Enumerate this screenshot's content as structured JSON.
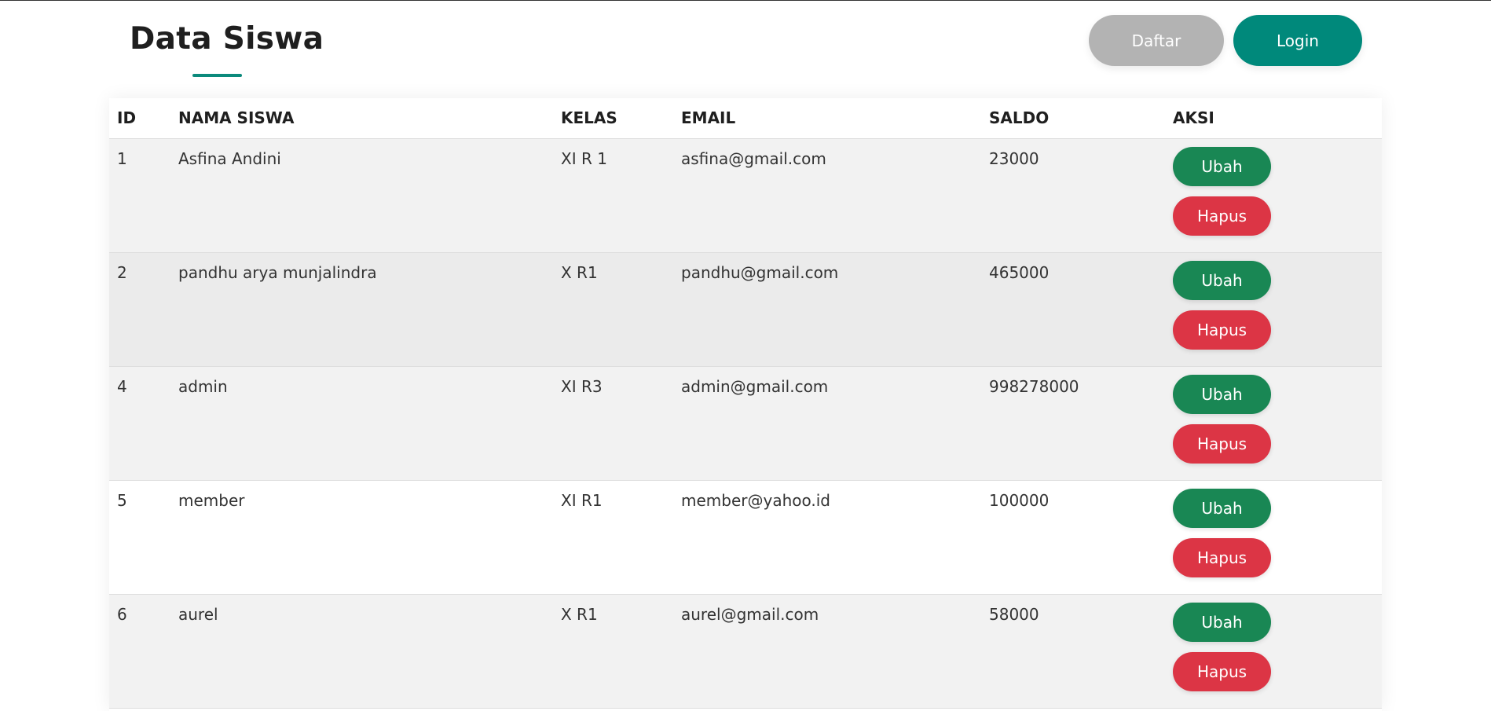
{
  "header": {
    "title": "Data Siswa",
    "daftar_label": "Daftar",
    "login_label": "Login"
  },
  "table": {
    "columns": {
      "id": "ID",
      "nama": "NAMA SISWA",
      "kelas": "KELAS",
      "email": "EMAIL",
      "saldo": "SALDO",
      "aksi": "AKSI"
    },
    "rows": [
      {
        "id": "1",
        "nama": "Asfina Andini",
        "kelas": "XI R 1",
        "email": "asfina@gmail.com",
        "saldo": "23000",
        "ubah": "Ubah",
        "hapus": "Hapus"
      },
      {
        "id": "2",
        "nama": "pandhu arya munjalindra",
        "kelas": "X R1",
        "email": "pandhu@gmail.com",
        "saldo": "465000",
        "ubah": "Ubah",
        "hapus": "Hapus"
      },
      {
        "id": "4",
        "nama": "admin",
        "kelas": "XI R3",
        "email": "admin@gmail.com",
        "saldo": "998278000",
        "ubah": "Ubah",
        "hapus": "Hapus"
      },
      {
        "id": "5",
        "nama": "member",
        "kelas": "XI R1",
        "email": "member@yahoo.id",
        "saldo": "100000",
        "ubah": "Ubah",
        "hapus": "Hapus"
      },
      {
        "id": "6",
        "nama": "aurel",
        "kelas": "X R1",
        "email": "aurel@gmail.com",
        "saldo": "58000",
        "ubah": "Ubah",
        "hapus": "Hapus"
      }
    ]
  },
  "colors": {
    "accent": "#00897b",
    "ubah": "#198754",
    "hapus": "#dc3545",
    "daftar": "#b3b3b3"
  }
}
